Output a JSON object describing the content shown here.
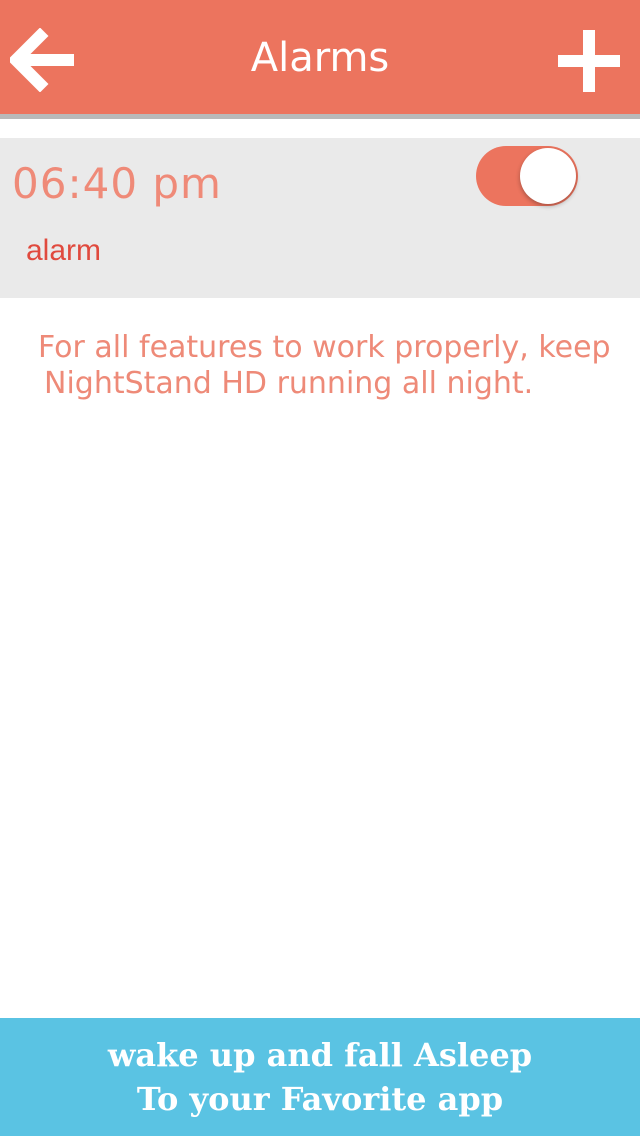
{
  "colors": {
    "nav_bg": "#EC745E",
    "row_bg": "#EAEAEA",
    "time_text": "#EF8A78",
    "label_text": "#E04A3E",
    "info_text": "#EE8A78",
    "banner_bg": "#5AC3E3"
  },
  "nav": {
    "title": "Alarms",
    "back_icon": "arrow-left-icon",
    "add_icon": "plus-icon"
  },
  "alarms": [
    {
      "time": "06:40 pm",
      "label": "alarm",
      "enabled": true
    }
  ],
  "info": {
    "line1": "For all features to work properly, keep",
    "line2": "NightStand HD running all night."
  },
  "banner": {
    "line1": "wake up and fall Asleep",
    "line2": "To your Favorite app"
  }
}
